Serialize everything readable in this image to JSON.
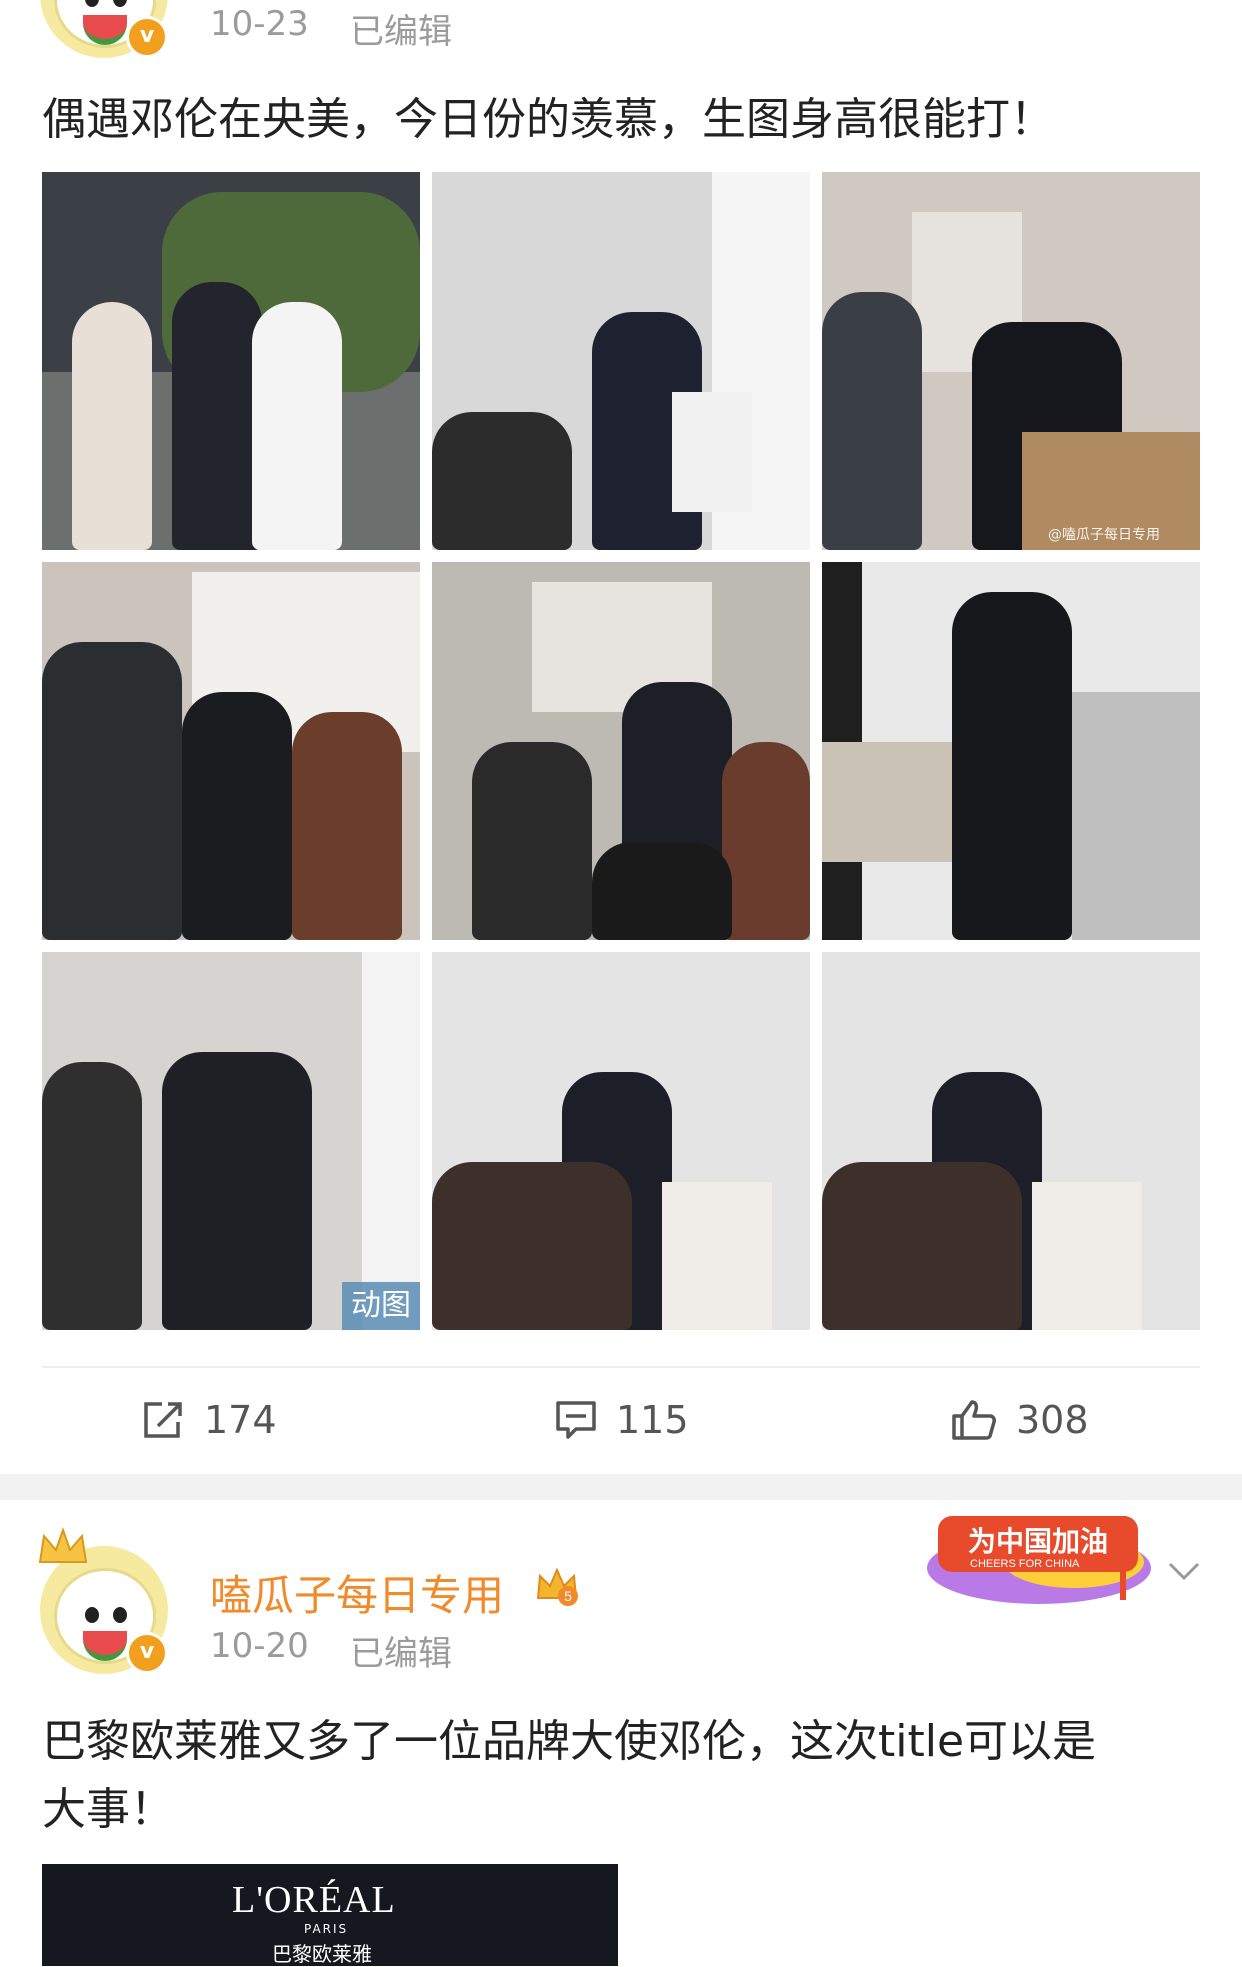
{
  "post1": {
    "date": "10-23",
    "edited": "已编辑",
    "text": "偶遇邓伦在央美，今日份的羡慕，生图身高很能打！",
    "gif_label": "动图",
    "watermark": "@嗑瓜子每日专用",
    "actions": {
      "repost": "174",
      "comment": "115",
      "like": "308"
    }
  },
  "post2": {
    "username": "嗑瓜子每日专用",
    "date": "10-20",
    "edited": "已编辑",
    "text_line1": "巴黎欧莱雅又多了一位品牌大使邓伦，这次title可以是",
    "text_line2": "大事！",
    "banner_title": "为中国加油",
    "banner_sub": "CHEERS FOR CHINA",
    "loreal_logo": "L'ORÉAL",
    "loreal_paris": "PARIS",
    "loreal_cn": "巴黎欧莱雅"
  },
  "colors": {
    "accent": "#f08a2a",
    "meta": "#9b9b9b",
    "badge": "#f29f1e"
  }
}
